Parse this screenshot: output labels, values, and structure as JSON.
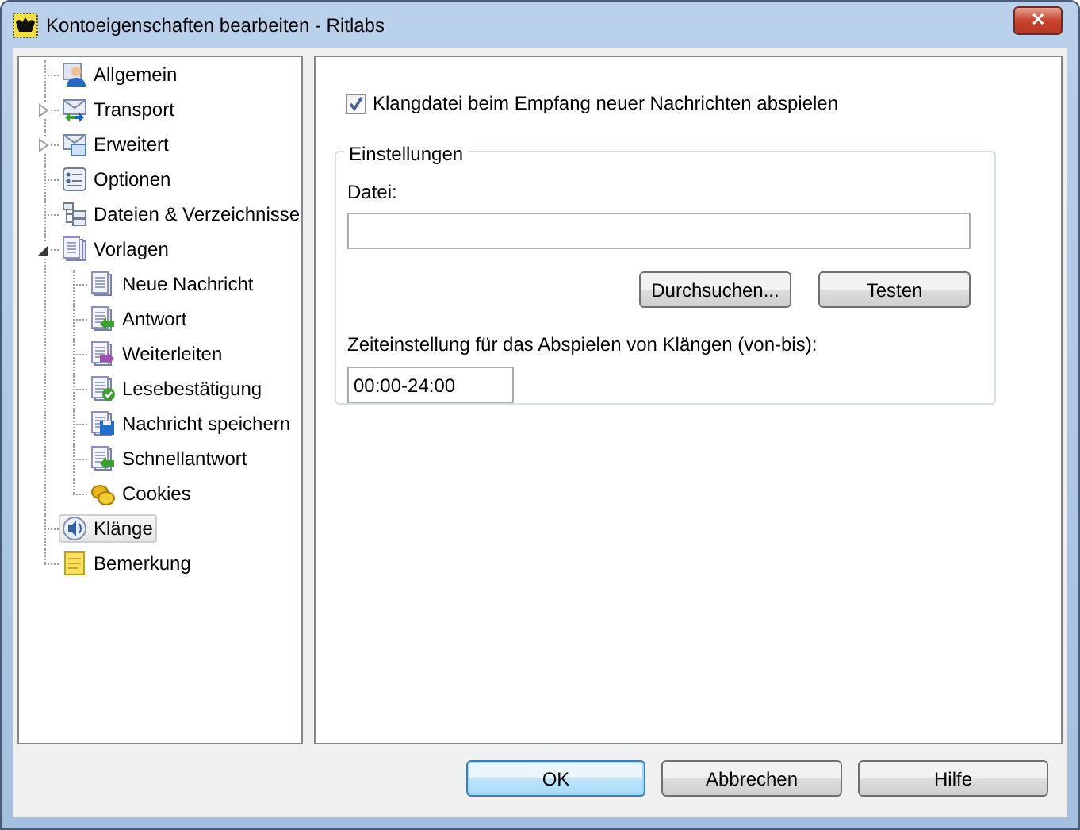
{
  "window": {
    "title": "Kontoeigenschaften bearbeiten - Ritlabs",
    "close": "✕"
  },
  "tree": [
    {
      "label": "Allgemein",
      "selected": false
    },
    {
      "label": "Transport",
      "selected": false,
      "expanded": false
    },
    {
      "label": "Erweitert",
      "selected": false,
      "expanded": false
    },
    {
      "label": "Optionen",
      "selected": false
    },
    {
      "label": "Dateien & Verzeichnisse",
      "selected": false
    },
    {
      "label": "Vorlagen",
      "selected": false,
      "expanded": true,
      "children": [
        {
          "label": "Neue Nachricht",
          "selected": false
        },
        {
          "label": "Antwort",
          "selected": false
        },
        {
          "label": "Weiterleiten",
          "selected": false
        },
        {
          "label": "Lesebestätigung",
          "selected": false
        },
        {
          "label": "Nachricht speichern",
          "selected": false
        },
        {
          "label": "Schnellantwort",
          "selected": false
        },
        {
          "label": "Cookies",
          "selected": false
        }
      ]
    },
    {
      "label": "Klänge",
      "selected": true
    },
    {
      "label": "Bemerkung",
      "selected": false
    }
  ],
  "panel": {
    "checkbox": {
      "label": "Klangdatei beim Empfang neuer Nachrichten abspielen",
      "checked": true
    },
    "group": {
      "title": "Einstellungen",
      "file_label": "Datei:",
      "buttons": [
        "Durchsuchen...",
        "Testen"
      ],
      "time_label": "Zeiteinstellung für das Abspielen von Klängen (von-bis):",
      "time_value": "00:00-24:00"
    }
  },
  "buttons": [
    {
      "label": "OK",
      "default": true
    },
    {
      "label": "Abbrechen",
      "default": false
    },
    {
      "label": "Hilfe",
      "default": false
    }
  ]
}
